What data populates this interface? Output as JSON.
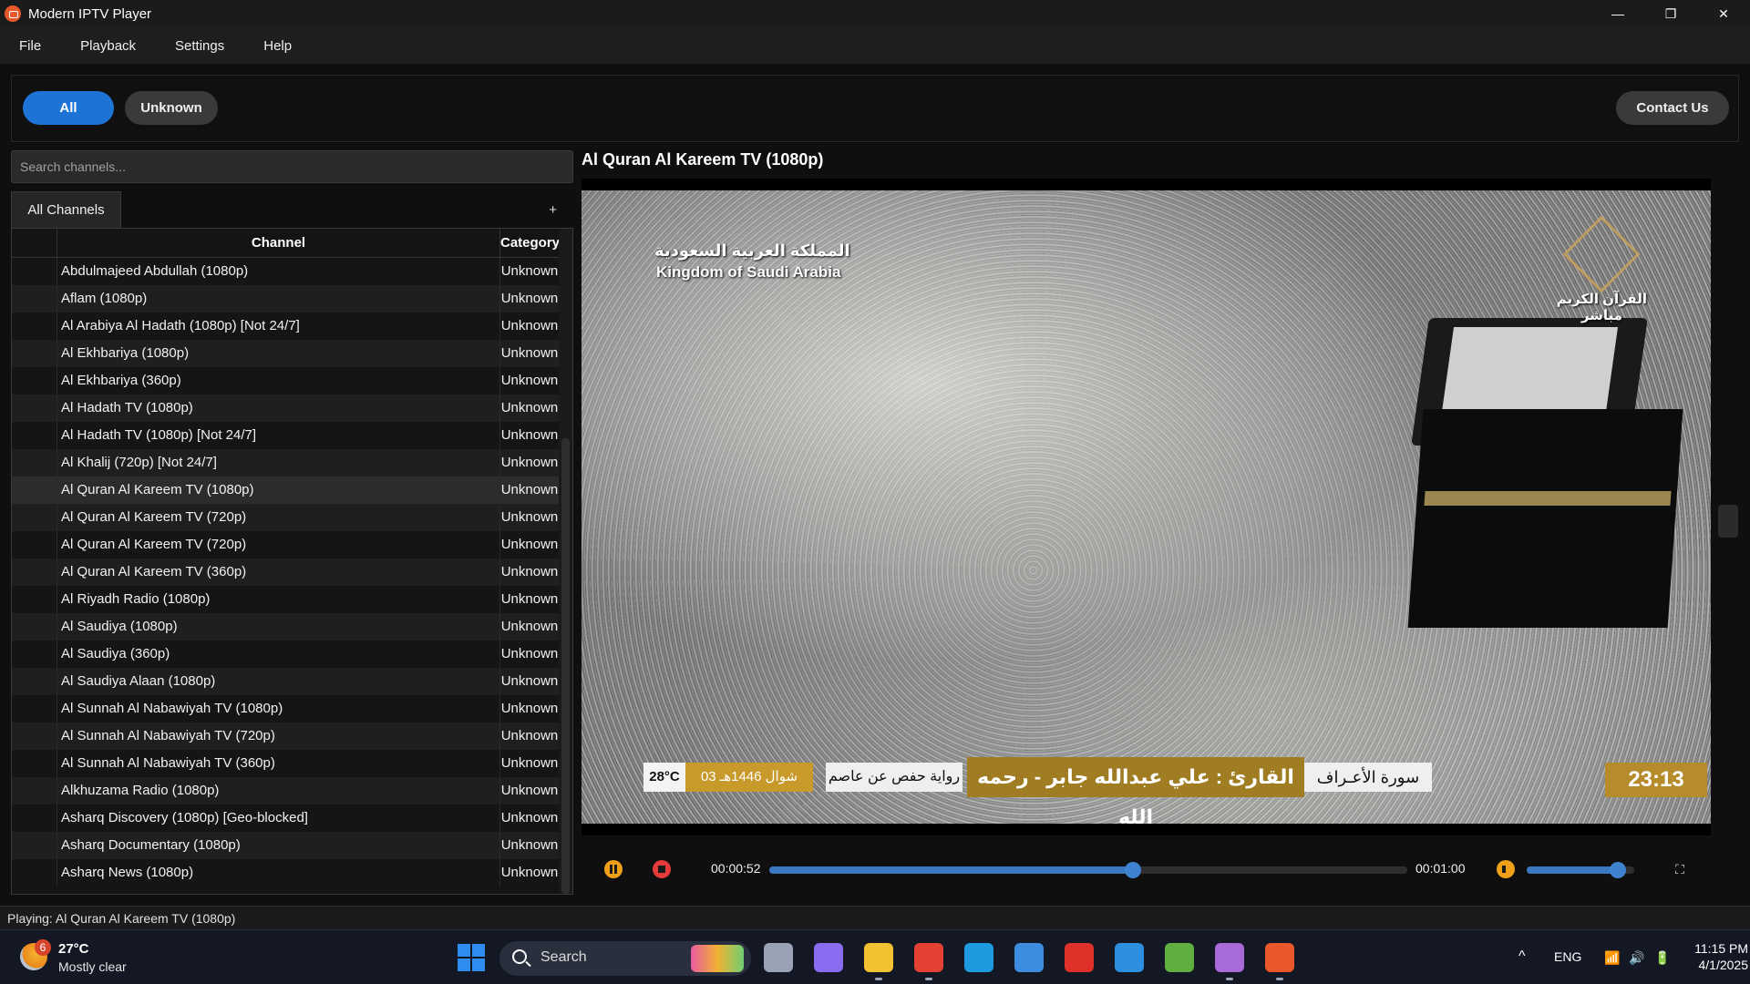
{
  "window": {
    "title": "Modern IPTV Player",
    "controls": [
      "—",
      "❐",
      "✕"
    ]
  },
  "menu": [
    "File",
    "Playback",
    "Settings",
    "Help"
  ],
  "filters": {
    "all_label": "All",
    "unknown_label": "Unknown",
    "contact_label": "Contact Us"
  },
  "sidebar": {
    "search_placeholder": "Search channels...",
    "tab_label": "All Channels",
    "add_tab_label": "+",
    "columns": {
      "channel": "Channel",
      "category": "Category"
    },
    "selected_index": 8,
    "rows": [
      {
        "channel": "Abdulmajeed Abdullah (1080p)",
        "category": "Unknown"
      },
      {
        "channel": "Aflam (1080p)",
        "category": "Unknown"
      },
      {
        "channel": "Al Arabiya Al Hadath (1080p) [Not 24/7]",
        "category": "Unknown"
      },
      {
        "channel": "Al Ekhbariya (1080p)",
        "category": "Unknown"
      },
      {
        "channel": "Al Ekhbariya (360p)",
        "category": "Unknown"
      },
      {
        "channel": "Al Hadath TV (1080p)",
        "category": "Unknown"
      },
      {
        "channel": "Al Hadath TV (1080p) [Not 24/7]",
        "category": "Unknown"
      },
      {
        "channel": "Al Khalij (720p) [Not 24/7]",
        "category": "Unknown"
      },
      {
        "channel": "Al Quran Al Kareem TV (1080p)",
        "category": "Unknown"
      },
      {
        "channel": "Al Quran Al Kareem TV (720p)",
        "category": "Unknown"
      },
      {
        "channel": "Al Quran Al Kareem TV (720p)",
        "category": "Unknown"
      },
      {
        "channel": "Al Quran Al Kareem TV (360p)",
        "category": "Unknown"
      },
      {
        "channel": "Al Riyadh Radio (1080p)",
        "category": "Unknown"
      },
      {
        "channel": "Al Saudiya (1080p)",
        "category": "Unknown"
      },
      {
        "channel": "Al Saudiya (360p)",
        "category": "Unknown"
      },
      {
        "channel": "Al Saudiya Alaan (1080p)",
        "category": "Unknown"
      },
      {
        "channel": "Al Sunnah Al Nabawiyah TV (1080p)",
        "category": "Unknown"
      },
      {
        "channel": "Al Sunnah Al Nabawiyah TV (720p)",
        "category": "Unknown"
      },
      {
        "channel": "Al Sunnah Al Nabawiyah TV (360p)",
        "category": "Unknown"
      },
      {
        "channel": "Alkhuzama Radio (1080p)",
        "category": "Unknown"
      },
      {
        "channel": "Asharq Discovery (1080p) [Geo-blocked]",
        "category": "Unknown"
      },
      {
        "channel": "Asharq Documentary (1080p)",
        "category": "Unknown"
      },
      {
        "channel": "Asharq News (1080p)",
        "category": "Unknown"
      }
    ]
  },
  "player": {
    "title": "Al Quran Al Kareem TV (1080p)",
    "overlay": {
      "logo_ar": "المملكة العربية السعودية",
      "logo_en": "Kingdom of Saudi Arabia",
      "brand": "القرآن الكريم\nمباشر",
      "temp": "28°C",
      "date": "03 شوال 1446هـ",
      "narration": "رواية حفص عن عاصم",
      "reader": "القارئ : علي عبدالله جابر - رحمه الله",
      "sura": "سورة الأعـراف",
      "clock": "23:13"
    },
    "time_current": "00:00:52",
    "time_total": "00:01:00",
    "progress": 0.57,
    "volume": 0.85,
    "fullscreen_glyph": "⛶"
  },
  "status": "Playing: Al Quran Al Kareem TV (1080p)",
  "taskbar": {
    "weather_temp": "27°C",
    "weather_desc": "Mostly clear",
    "weather_badge": "6",
    "search_label": "Search",
    "lang": "ENG",
    "chevron": "^",
    "time": "11:15 PM",
    "date": "4/1/2025",
    "apps": [
      {
        "name": "task-view-icon",
        "color": "#9aa3b5"
      },
      {
        "name": "copilot-icon",
        "color": "#8a6cf0"
      },
      {
        "name": "file-explorer-icon",
        "color": "#f2c233"
      },
      {
        "name": "chrome-icon",
        "color": "#e34133"
      },
      {
        "name": "edge-icon",
        "color": "#1e9be0"
      },
      {
        "name": "store-icon",
        "color": "#3c8de0"
      },
      {
        "name": "red-app-icon",
        "color": "#e0302a"
      },
      {
        "name": "vscode-icon",
        "color": "#2d8fe0"
      },
      {
        "name": "network-app-icon",
        "color": "#5fae3f"
      },
      {
        "name": "github-icon",
        "color": "#a86ad8"
      },
      {
        "name": "iptv-player-icon",
        "color": "#e8582a"
      }
    ]
  }
}
